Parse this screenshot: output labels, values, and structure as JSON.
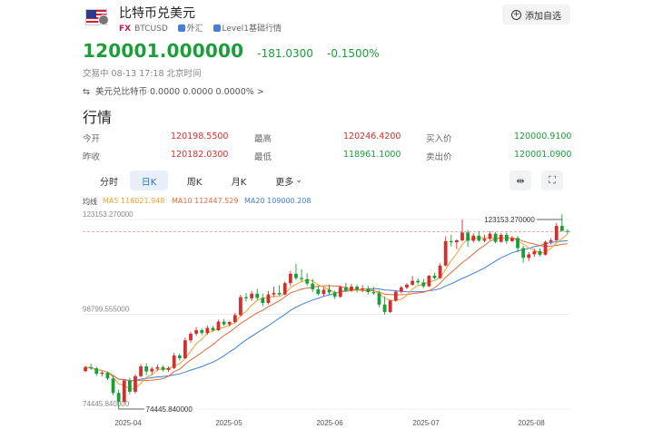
{
  "header": {
    "title": "比特币兑美元",
    "badge_fx": "FX",
    "symbol": "BTCUSD",
    "market": "外汇",
    "level": "Level1基础行情",
    "watch_label": "添加自选"
  },
  "quote": {
    "price": "120001.000000",
    "change": "-181.0300",
    "change_pct": "-0.1500%",
    "status": "交易中 08-13 17:18 北京时间",
    "conversion": "美元兑比特币 0.0000 0.0000 0.0000% >"
  },
  "section_title": "行情",
  "stats": {
    "open_label": "今开",
    "open": "120198.5500",
    "high_label": "最高",
    "high": "120246.4200",
    "bid_label": "买入价",
    "bid": "120000.9100",
    "prev_label": "昨收",
    "prev": "120182.0300",
    "low_label": "最低",
    "low": "118961.1000",
    "ask_label": "卖出价",
    "ask": "120001.0900"
  },
  "tabs": [
    "分时",
    "日K",
    "周K",
    "月K",
    "更多"
  ],
  "active_tab": "日K",
  "tools": {
    "expand_icon": "split-arrows-icon",
    "fullscreen_icon": "fullscreen-icon"
  },
  "ma": {
    "label": "均线",
    "ma5": "MA5 116021.948",
    "ma10": "MA10 112447.529",
    "ma20": "MA20 109000.208"
  },
  "colors": {
    "up": "#d32f2f",
    "down": "#1a9e3a",
    "ma5": "#f0a030",
    "ma10": "#e06a3a",
    "ma20": "#3f7fd9"
  },
  "chart_data": {
    "type": "candlestick",
    "y_tick_labels": [
      "123153.270000",
      "98799.555000",
      "74445.840000"
    ],
    "y_ticks": [
      123153.27,
      98799.555,
      74445.84
    ],
    "x_tick_labels": [
      "2025-04",
      "2025-05",
      "2025-06",
      "2025-07",
      "2025-08"
    ],
    "ylim": [
      74445.84,
      123153.27
    ],
    "max_label": "123153.270000",
    "min_label": "74445.840000",
    "max_value": 123153.27,
    "min_value": 74445.84,
    "reference_line": 120001.0,
    "candles": [
      [
        84200,
        85600,
        83900,
        85200
      ],
      [
        85200,
        86100,
        84500,
        84900
      ],
      [
        84900,
        85300,
        83000,
        83500
      ],
      [
        83500,
        84200,
        82800,
        83800
      ],
      [
        83800,
        84100,
        81900,
        82300
      ],
      [
        82300,
        83000,
        78000,
        78600
      ],
      [
        78600,
        79500,
        74446,
        76300
      ],
      [
        76300,
        82100,
        75900,
        81800
      ],
      [
        81800,
        82500,
        78200,
        78900
      ],
      [
        78900,
        83400,
        78400,
        82900
      ],
      [
        82900,
        86000,
        82600,
        85400
      ],
      [
        85400,
        86200,
        83200,
        84100
      ],
      [
        84100,
        85300,
        83400,
        84800
      ],
      [
        84800,
        85900,
        84300,
        85200
      ],
      [
        85200,
        85700,
        84100,
        84500
      ],
      [
        84500,
        85400,
        84000,
        85000
      ],
      [
        85000,
        88900,
        84700,
        88200
      ],
      [
        88200,
        88700,
        86900,
        87500
      ],
      [
        87500,
        92800,
        87300,
        92100
      ],
      [
        92100,
        94300,
        91500,
        93800
      ],
      [
        93800,
        95500,
        93200,
        94700
      ],
      [
        94700,
        95200,
        93400,
        94000
      ],
      [
        94000,
        95900,
        93500,
        95300
      ],
      [
        95300,
        95800,
        94300,
        94700
      ],
      [
        94700,
        97400,
        94500,
        96900
      ],
      [
        96900,
        97600,
        95800,
        96200
      ],
      [
        96200,
        97100,
        95600,
        96800
      ],
      [
        96800,
        99200,
        96500,
        98600
      ],
      [
        98600,
        103800,
        98300,
        103200
      ],
      [
        103200,
        104300,
        102100,
        102900
      ],
      [
        102900,
        104800,
        102300,
        104100
      ],
      [
        104100,
        105300,
        102500,
        103000
      ],
      [
        103000,
        104100,
        100900,
        101700
      ],
      [
        101700,
        104800,
        101300,
        103900
      ],
      [
        103900,
        105900,
        103200,
        104300
      ],
      [
        104300,
        106300,
        103600,
        103900
      ],
      [
        103900,
        107200,
        103700,
        106800
      ],
      [
        106800,
        109900,
        106100,
        109200
      ],
      [
        109200,
        111800,
        107600,
        108100
      ],
      [
        108100,
        110400,
        107200,
        107800
      ],
      [
        107800,
        109300,
        106100,
        106700
      ],
      [
        106700,
        107900,
        104500,
        105200
      ],
      [
        105200,
        106100,
        103600,
        104000
      ],
      [
        104000,
        105700,
        103300,
        105100
      ],
      [
        105100,
        106400,
        103900,
        104400
      ],
      [
        104400,
        104900,
        102700,
        103300
      ],
      [
        103300,
        106200,
        103000,
        105800
      ],
      [
        105800,
        106900,
        104500,
        104900
      ],
      [
        104900,
        106600,
        104500,
        105900
      ],
      [
        105900,
        106400,
        104400,
        105100
      ],
      [
        105100,
        106300,
        104400,
        105400
      ],
      [
        105400,
        106100,
        103900,
        104500
      ],
      [
        104500,
        105800,
        103800,
        104200
      ],
      [
        104200,
        104900,
        100600,
        101300
      ],
      [
        101300,
        103400,
        98700,
        99400
      ],
      [
        99400,
        102600,
        99100,
        102300
      ],
      [
        102300,
        104800,
        102000,
        104600
      ],
      [
        104600,
        106100,
        104200,
        105700
      ],
      [
        105700,
        106800,
        105300,
        106400
      ],
      [
        106400,
        108600,
        106100,
        107400
      ],
      [
        107400,
        108000,
        106500,
        107000
      ],
      [
        107000,
        107900,
        105500,
        106000
      ],
      [
        106000,
        108900,
        105800,
        108700
      ],
      [
        108700,
        109500,
        107800,
        108100
      ],
      [
        108100,
        111900,
        107900,
        111300
      ],
      [
        111300,
        118800,
        111100,
        117600
      ],
      [
        117600,
        119200,
        116200,
        117300
      ],
      [
        117300,
        118100,
        115500,
        117800
      ],
      [
        117800,
        123153,
        117500,
        119800
      ],
      [
        119800,
        120500,
        116100,
        117700
      ],
      [
        117700,
        119600,
        117200,
        119000
      ],
      [
        119000,
        120200,
        117400,
        117700
      ],
      [
        117700,
        119300,
        117300,
        118200
      ],
      [
        118200,
        120100,
        117800,
        119500
      ],
      [
        119500,
        119900,
        117000,
        117400
      ],
      [
        117400,
        119600,
        117200,
        119200
      ],
      [
        119200,
        119800,
        116900,
        117600
      ],
      [
        117600,
        118900,
        117300,
        118400
      ],
      [
        118400,
        118900,
        114700,
        115800
      ],
      [
        115800,
        116400,
        112000,
        113300
      ],
      [
        113300,
        114800,
        112500,
        114200
      ],
      [
        114200,
        115600,
        113600,
        115000
      ],
      [
        115000,
        115700,
        113700,
        114100
      ],
      [
        114100,
        117700,
        113900,
        117400
      ],
      [
        117400,
        118300,
        116700,
        117800
      ],
      [
        117800,
        122300,
        117600,
        121500
      ],
      [
        121500,
        124500,
        120400,
        120200
      ],
      [
        120200,
        120700,
        119400,
        120001
      ]
    ]
  }
}
